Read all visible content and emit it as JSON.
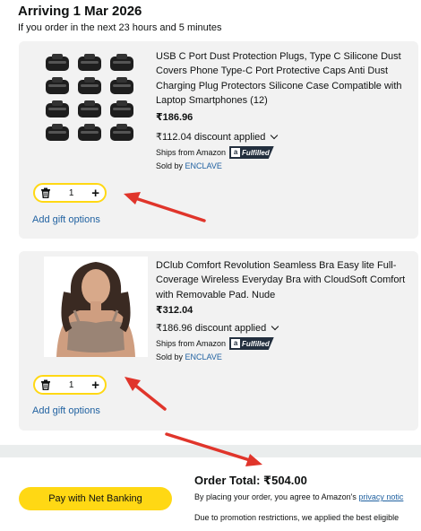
{
  "header": {
    "title": "Arriving 1 Mar 2026",
    "subtitle": "If you order in the next 23 hours and 5 minutes"
  },
  "items": [
    {
      "title": "USB C Port Dust Protection Plugs, Type C Silicone Dust Covers Phone Type-C Port Protective Caps Anti Dust Charging Plug Protectors Silicone Case Compatible with Laptop Smartphones (12)",
      "price": "₹186.96",
      "discount": "₹112.04 discount applied",
      "ships_from": "Ships from Amazon",
      "fulfilled": "Fulfilled",
      "sold_by_label": "Sold by",
      "seller": "ENCLAVE",
      "quantity": "1",
      "gift": "Add gift options"
    },
    {
      "title": "DClub Comfort Revolution Seamless Bra Easy lite Full-Coverage Wireless Everyday Bra with CloudSoft Comfort with Removable Pad. Nude",
      "price": "₹312.04",
      "discount": "₹186.96 discount applied",
      "ships_from": "Ships from Amazon",
      "fulfilled": "Fulfilled",
      "sold_by_label": "Sold by",
      "seller": "ENCLAVE",
      "quantity": "1",
      "gift": "Add gift options"
    }
  ],
  "summary": {
    "pay_button": "Pay with Net Banking",
    "order_total": "Order Total: ₹504.00",
    "agree_text": "By placing your order, you agree to Amazon's",
    "privacy_link": "privacy notic",
    "promo_text": "Due to promotion restrictions, we applied the best eligible"
  },
  "colors": {
    "accent_yellow": "#ffd814",
    "link": "#2162a1",
    "arrow": "#e0352b"
  }
}
